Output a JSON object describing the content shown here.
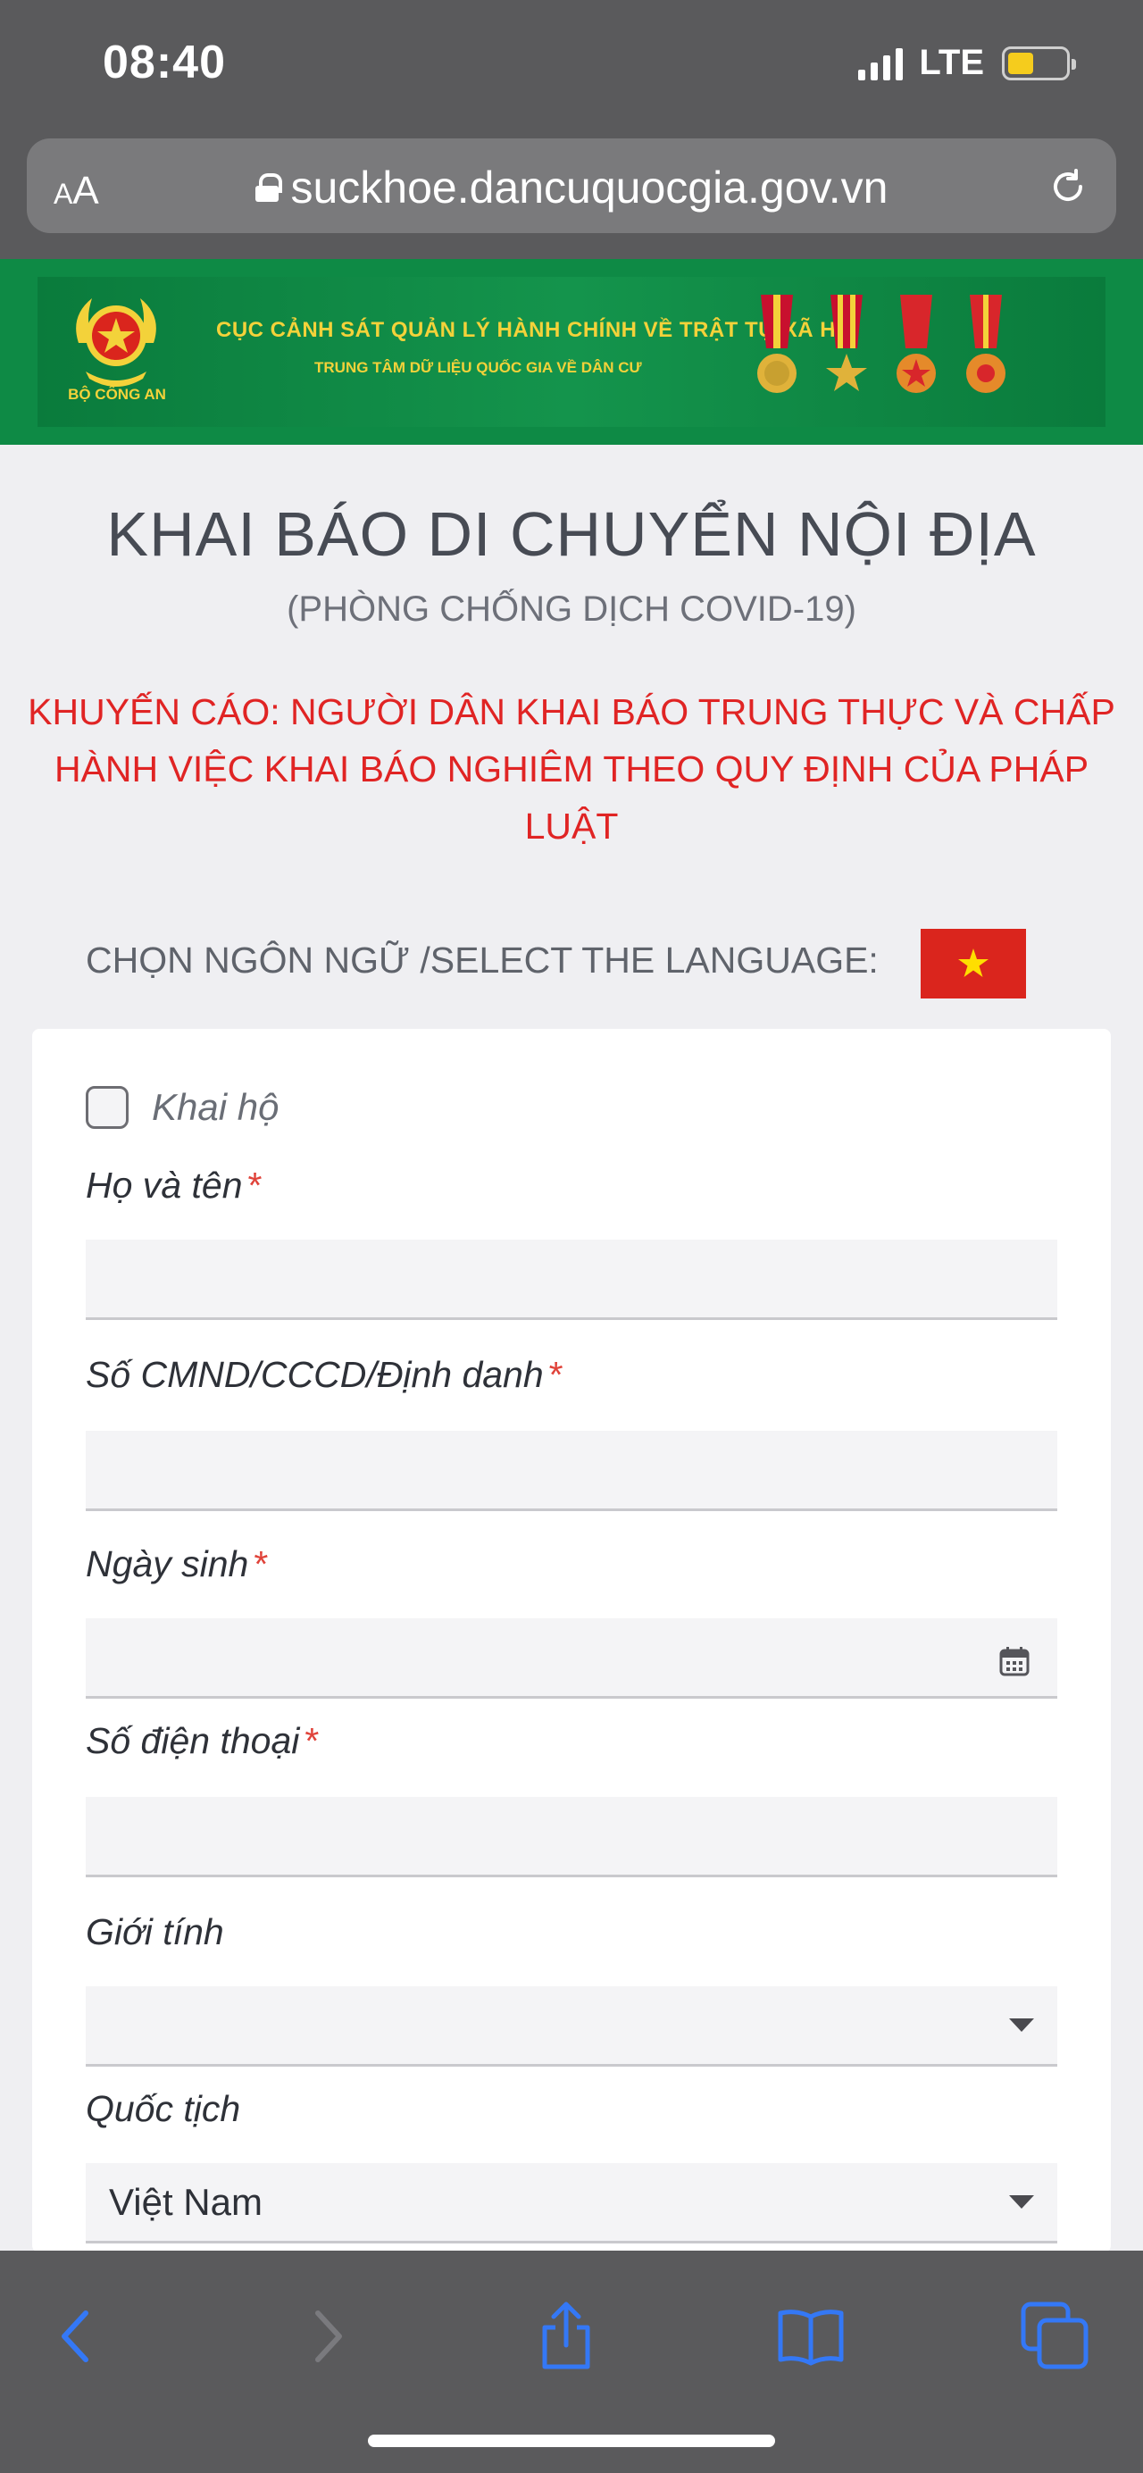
{
  "status": {
    "time": "08:40",
    "network": "LTE",
    "battery_level": 0.45,
    "battery_color": "#f5cc1d"
  },
  "browser": {
    "text_size_label": "AA",
    "url": "suckhoe.dancuquocgia.gov.vn"
  },
  "banner": {
    "emblem_caption": "BỘ CÔNG AN",
    "line1": "CỤC CẢNH SÁT QUẢN LÝ HÀNH CHÍNH VỀ TRẬT TỰ XÃ HỘI",
    "line2": "TRUNG TÂM DỮ LIỆU QUỐC GIA VỀ DÂN CƯ",
    "background": "#0e8a45",
    "text_color": "#f3d23a"
  },
  "page": {
    "title": "KHAI BÁO DI CHUYỂN NỘI ĐỊA",
    "subtitle": "(PHÒNG CHỐNG DỊCH COVID-19)",
    "warning": "KHUYẾN CÁO: NGƯỜI DÂN KHAI BÁO TRUNG THỰC VÀ CHẤP HÀNH VIỆC KHAI BÁO NGHIÊM THEO QUY ĐỊNH CỦA PHÁP LUẬT",
    "warning_color": "#e02424",
    "language_label": "CHỌN NGÔN NGỮ /SELECT THE LANGUAGE:",
    "language_flag": "vietnam-flag"
  },
  "form": {
    "proxy_label": "Khai hộ",
    "proxy_checked": false,
    "required_mark": "*",
    "fields": {
      "full_name": {
        "label": "Họ và tên",
        "value": ""
      },
      "id_number": {
        "label": "Số CMND/CCCD/Định danh",
        "value": ""
      },
      "dob": {
        "label": "Ngày sinh",
        "value": ""
      },
      "phone": {
        "label": "Số điện thoại",
        "value": ""
      },
      "gender": {
        "label": "Giới tính",
        "value": ""
      },
      "nationality": {
        "label": "Quốc tịch",
        "value": "Việt Nam"
      }
    }
  },
  "toolbar": {
    "icons": [
      "back-icon",
      "forward-icon",
      "share-icon",
      "bookmarks-icon",
      "tabs-icon"
    ],
    "accent": "#3478f6"
  }
}
